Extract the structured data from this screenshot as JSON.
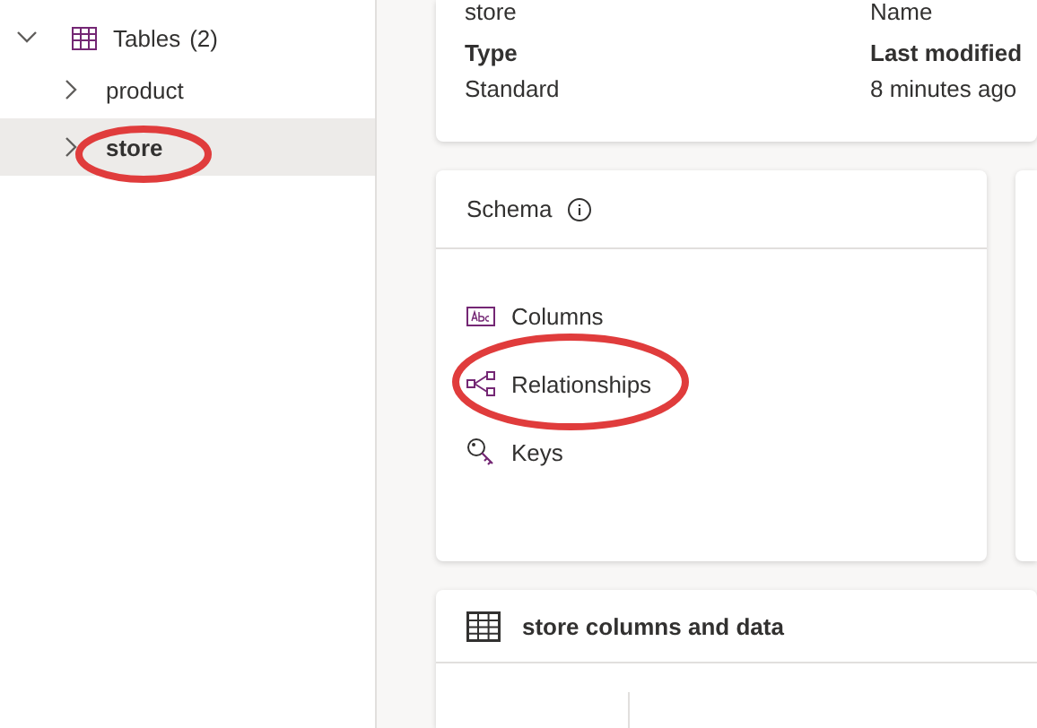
{
  "sidebar": {
    "group": {
      "label": "Tables",
      "count": "(2)",
      "expanded": true,
      "children": [
        {
          "label": "product",
          "selected": false
        },
        {
          "label": "store",
          "selected": true
        }
      ]
    }
  },
  "details": {
    "cut_row": [
      "store",
      "Name"
    ],
    "fields": [
      {
        "label": "Type",
        "value": "Standard"
      },
      {
        "label": "Last modified",
        "value": "8 minutes ago"
      }
    ]
  },
  "schema": {
    "title": "Schema",
    "items": [
      {
        "kind": "columns",
        "label": "Columns"
      },
      {
        "kind": "relationships",
        "label": "Relationships"
      },
      {
        "kind": "keys",
        "label": "Keys"
      }
    ]
  },
  "data_card": {
    "title": "store columns and data"
  }
}
